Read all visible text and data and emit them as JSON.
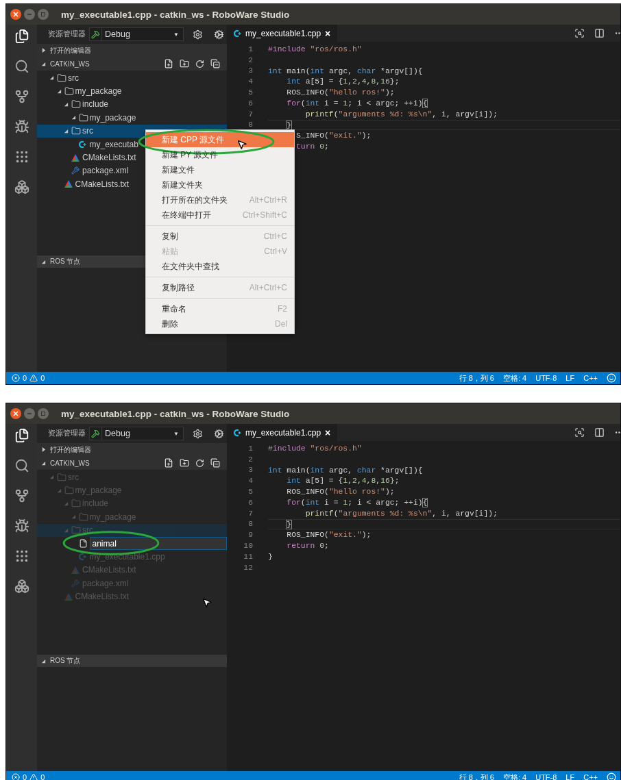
{
  "screens": [
    {
      "window": {
        "title": "my_executable1.cpp - catkin_ws - RoboWare Studio"
      },
      "explorer": {
        "title": "资源管理器",
        "config": "Debug",
        "caret": "▼"
      },
      "sections": [
        {
          "label": "打开的编辑器",
          "expanded": false
        },
        {
          "label": "CATKIN_WS",
          "expanded": true
        }
      ],
      "tree": {
        "dimmed": false,
        "items": [
          {
            "kind": "folder",
            "label": "src",
            "expanded": true,
            "selected": false,
            "children": [
              {
                "kind": "folder",
                "label": "my_package",
                "expanded": true,
                "selected": false,
                "children": [
                  {
                    "kind": "folder",
                    "label": "include",
                    "expanded": true,
                    "selected": false,
                    "children": [
                      {
                        "kind": "folder",
                        "label": "my_package",
                        "expanded": true,
                        "selected": false
                      }
                    ]
                  },
                  {
                    "kind": "folder",
                    "label": "src",
                    "expanded": true,
                    "selected": true,
                    "children": [
                      {
                        "kind": "cpp",
                        "label": "my_executab",
                        "selected": false
                      }
                    ]
                  },
                  {
                    "kind": "cmake",
                    "label": "CMakeLists.txt",
                    "selected": false
                  },
                  {
                    "kind": "xml",
                    "label": "package.xml",
                    "selected": false
                  }
                ]
              },
              {
                "kind": "cmake",
                "label": "CMakeLists.txt",
                "selected": false
              }
            ]
          }
        ]
      },
      "ros_section": {
        "label": "ROS 节点",
        "expanded": true
      },
      "editor": {
        "tab": {
          "label": "my_executable1.cpp",
          "close": "×"
        },
        "lines": [
          {
            "number": "1",
            "current": false,
            "tokens": [
              {
                "kind": "control",
                "text": "#include"
              },
              {
                "kind": "string",
                "text": " \"ros/ros.h\""
              }
            ]
          },
          {
            "number": "2"
          },
          {
            "number": "3",
            "current": false,
            "tokens": [
              {
                "kind": "keyword",
                "text": "int"
              },
              {
                "kind": "plain",
                "text": " main("
              },
              {
                "kind": "keyword",
                "text": "int"
              },
              {
                "kind": "plain",
                "text": " argc, "
              },
              {
                "kind": "keyword",
                "text": "char"
              },
              {
                "kind": "plain",
                "text": " *argv[]){"
              }
            ]
          },
          {
            "number": "4",
            "current": false,
            "tokens": [
              {
                "kind": "keyword",
                "text": "    int"
              },
              {
                "kind": "plain",
                "text": " a[5] = {"
              },
              {
                "kind": "number",
                "text": "1"
              },
              {
                "kind": "plain",
                "text": ","
              },
              {
                "kind": "number",
                "text": "2"
              },
              {
                "kind": "plain",
                "text": ","
              },
              {
                "kind": "number",
                "text": "4"
              },
              {
                "kind": "plain",
                "text": ","
              },
              {
                "kind": "number",
                "text": "8"
              },
              {
                "kind": "plain",
                "text": ","
              },
              {
                "kind": "number",
                "text": "16"
              },
              {
                "kind": "plain",
                "text": "};"
              }
            ]
          },
          {
            "number": "5",
            "current": false,
            "tokens": [
              {
                "kind": "plain",
                "text": "    ROS_INFO("
              },
              {
                "kind": "string",
                "text": "\"hello ros!\""
              },
              {
                "kind": "plain",
                "text": ");"
              }
            ]
          },
          {
            "number": "6",
            "current": false,
            "tokens": [
              {
                "kind": "control",
                "text": "    for"
              },
              {
                "kind": "plain",
                "text": "("
              },
              {
                "kind": "keyword",
                "text": "int"
              },
              {
                "kind": "plain",
                "text": " i = "
              },
              {
                "kind": "number",
                "text": "1"
              },
              {
                "kind": "plain",
                "text": "; i < argc; ++i)"
              },
              {
                "kind": "bracket",
                "text": "{"
              }
            ]
          },
          {
            "number": "7",
            "current": false,
            "tokens": [
              {
                "kind": "function",
                "text": "        printf"
              },
              {
                "kind": "plain",
                "text": "("
              },
              {
                "kind": "string",
                "text": "\"arguments %d: %s\\n\""
              },
              {
                "kind": "plain",
                "text": ", i, argv[i]);"
              }
            ]
          },
          {
            "number": "8",
            "current": true,
            "tokens": [
              {
                "kind": "bracket",
                "text": "}",
                "indent": true
              }
            ]
          },
          {
            "current": false,
            "tokens": [
              {
                "kind": "plain",
                "text": "      S_INFO("
              },
              {
                "kind": "string",
                "text": "\"exit.\""
              },
              {
                "kind": "plain",
                "text": ");"
              }
            ]
          },
          {
            "current": false,
            "tokens": [
              {
                "kind": "control",
                "text": "      turn"
              },
              {
                "kind": "number",
                "text": " 0"
              },
              {
                "kind": "plain",
                "text": ";"
              }
            ]
          }
        ]
      },
      "context_menu": {
        "items": [
          {
            "kind": "item",
            "label": "新建 CPP 源文件",
            "selected": true,
            "disabled": false,
            "circled": true,
            "hovered": true
          },
          {
            "kind": "item",
            "label": "新建 PY 源文件",
            "selected": false,
            "disabled": false
          },
          {
            "kind": "item",
            "label": "新建文件",
            "selected": false,
            "disabled": false
          },
          {
            "kind": "item",
            "label": "新建文件夹",
            "selected": false,
            "disabled": false
          },
          {
            "kind": "item",
            "label": "打开所在的文件夹",
            "shortcut": "Alt+Ctrl+R",
            "selected": false,
            "disabled": false
          },
          {
            "kind": "item",
            "label": "在终端中打开",
            "shortcut": "Ctrl+Shift+C",
            "selected": false,
            "disabled": false
          },
          {
            "kind": "separator"
          },
          {
            "kind": "item",
            "label": "复制",
            "shortcut": "Ctrl+C",
            "selected": false,
            "disabled": false
          },
          {
            "kind": "item",
            "label": "粘贴",
            "shortcut": "Ctrl+V",
            "selected": false,
            "disabled": true
          },
          {
            "kind": "item",
            "label": "在文件夹中查找",
            "selected": false,
            "disabled": false
          },
          {
            "kind": "separator"
          },
          {
            "kind": "item",
            "label": "复制路径",
            "shortcut": "Alt+Ctrl+C",
            "selected": false,
            "disabled": false
          },
          {
            "kind": "separator"
          },
          {
            "kind": "item",
            "label": "重命名",
            "shortcut": "F2",
            "selected": false,
            "disabled": false
          },
          {
            "kind": "item",
            "label": "删除",
            "shortcut": "Del",
            "selected": false,
            "disabled": false
          }
        ]
      },
      "status_bar": {
        "errors": "0",
        "warnings": "0",
        "items": [
          "行 8，列 6",
          "空格: 4",
          "UTF-8",
          "LF",
          "C++"
        ]
      }
    },
    {
      "window": {
        "title": "my_executable1.cpp - catkin_ws - RoboWare Studio"
      },
      "explorer": {
        "title": "资源管理器",
        "config": "Debug",
        "caret": "▼"
      },
      "sections": [
        {
          "label": "打开的编辑器",
          "expanded": false
        },
        {
          "label": "CATKIN_WS",
          "expanded": true
        }
      ],
      "tree": {
        "dimmed": true,
        "pointer": true,
        "items": [
          {
            "kind": "folder",
            "label": "src",
            "expanded": true,
            "selected": false,
            "children": [
              {
                "kind": "folder",
                "label": "my_package",
                "expanded": true,
                "selected": false,
                "children": [
                  {
                    "kind": "folder",
                    "label": "include",
                    "expanded": true,
                    "selected": false,
                    "children": [
                      {
                        "kind": "folder",
                        "label": "my_package",
                        "expanded": true,
                        "selected": false
                      }
                    ]
                  },
                  {
                    "kind": "folder",
                    "label": "src",
                    "expanded": true,
                    "selected": true,
                    "children": [
                      {
                        "kind": "input",
                        "value": "animal",
                        "circled": true
                      },
                      {
                        "kind": "cpp",
                        "label": "my_executable1.cpp",
                        "selected": false
                      }
                    ]
                  },
                  {
                    "kind": "cmake",
                    "label": "CMakeLists.txt",
                    "selected": false
                  },
                  {
                    "kind": "xml",
                    "label": "package.xml",
                    "selected": false
                  }
                ]
              },
              {
                "kind": "cmake",
                "label": "CMakeLists.txt",
                "selected": false
              }
            ]
          }
        ]
      },
      "ros_section": {
        "label": "ROS 节点",
        "expanded": true
      },
      "editor": {
        "tab": {
          "label": "my_executable1.cpp",
          "close": "×"
        },
        "lines": [
          {
            "number": "1",
            "current": false,
            "tokens": [
              {
                "kind": "control",
                "text": "#include"
              },
              {
                "kind": "string",
                "text": " \"ros/ros.h\""
              }
            ]
          },
          {
            "number": "2"
          },
          {
            "number": "3",
            "current": false,
            "tokens": [
              {
                "kind": "keyword",
                "text": "int"
              },
              {
                "kind": "plain",
                "text": " main("
              },
              {
                "kind": "keyword",
                "text": "int"
              },
              {
                "kind": "plain",
                "text": " argc, "
              },
              {
                "kind": "keyword",
                "text": "char"
              },
              {
                "kind": "plain",
                "text": " *argv[]){"
              }
            ]
          },
          {
            "number": "4",
            "current": false,
            "tokens": [
              {
                "kind": "keyword",
                "text": "    int"
              },
              {
                "kind": "plain",
                "text": " a[5] = {"
              },
              {
                "kind": "number",
                "text": "1"
              },
              {
                "kind": "plain",
                "text": ","
              },
              {
                "kind": "number",
                "text": "2"
              },
              {
                "kind": "plain",
                "text": ","
              },
              {
                "kind": "number",
                "text": "4"
              },
              {
                "kind": "plain",
                "text": ","
              },
              {
                "kind": "number",
                "text": "8"
              },
              {
                "kind": "plain",
                "text": ","
              },
              {
                "kind": "number",
                "text": "16"
              },
              {
                "kind": "plain",
                "text": "};"
              }
            ]
          },
          {
            "number": "5",
            "current": false,
            "tokens": [
              {
                "kind": "plain",
                "text": "    ROS_INFO("
              },
              {
                "kind": "string",
                "text": "\"hello ros!\""
              },
              {
                "kind": "plain",
                "text": ");"
              }
            ]
          },
          {
            "number": "6",
            "current": false,
            "tokens": [
              {
                "kind": "control",
                "text": "    for"
              },
              {
                "kind": "plain",
                "text": "("
              },
              {
                "kind": "keyword",
                "text": "int"
              },
              {
                "kind": "plain",
                "text": " i = "
              },
              {
                "kind": "number",
                "text": "1"
              },
              {
                "kind": "plain",
                "text": "; i < argc; ++i)"
              },
              {
                "kind": "bracket",
                "text": "{"
              }
            ]
          },
          {
            "number": "7",
            "current": false,
            "tokens": [
              {
                "kind": "function",
                "text": "        printf"
              },
              {
                "kind": "plain",
                "text": "("
              },
              {
                "kind": "string",
                "text": "\"arguments %d: %s\\n\""
              },
              {
                "kind": "plain",
                "text": ", i, argv[i]);"
              }
            ]
          },
          {
            "number": "8",
            "current": true,
            "tokens": [
              {
                "kind": "bracket",
                "text": "}",
                "indent": true
              }
            ]
          },
          {
            "number": "9",
            "current": false,
            "tokens": [
              {
                "kind": "plain",
                "text": "    ROS_INFO("
              },
              {
                "kind": "string",
                "text": "\"exit.\""
              },
              {
                "kind": "plain",
                "text": ");"
              }
            ]
          },
          {
            "number": "10",
            "current": false,
            "tokens": [
              {
                "kind": "control",
                "text": "    return"
              },
              {
                "kind": "number",
                "text": " 0"
              },
              {
                "kind": "plain",
                "text": ";"
              }
            ]
          },
          {
            "number": "11",
            "current": false,
            "tokens": [
              {
                "kind": "plain",
                "text": "}"
              }
            ]
          },
          {
            "number": "12"
          }
        ]
      },
      "status_bar": {
        "errors": "0",
        "warnings": "0",
        "items": [
          "行 8，列 6",
          "空格: 4",
          "UTF-8",
          "LF",
          "C++"
        ]
      }
    }
  ]
}
